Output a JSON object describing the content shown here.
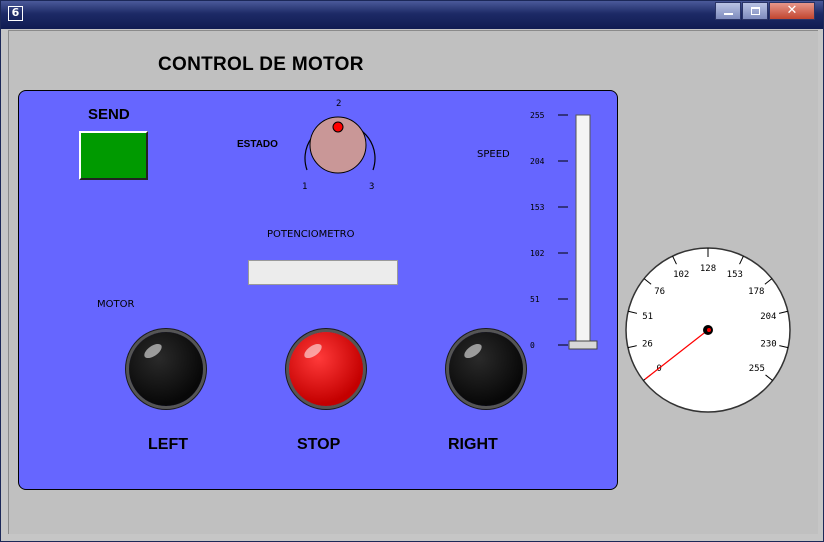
{
  "window": {
    "app_icon_glyph": "6",
    "minimize_icon": "minimize-icon",
    "maximize_icon": "maximize-icon",
    "close_glyph": "✕"
  },
  "heading": "CONTROL DE MOTOR",
  "panel_color": "#6666ff",
  "send": {
    "label": "SEND",
    "button_color": "#009a00"
  },
  "estado": {
    "label": "ESTADO",
    "ticks": [
      "1",
      "2",
      "3"
    ],
    "current": "2",
    "knob_color": "#c99797",
    "indicator_color": "#ff0000"
  },
  "speed_slider": {
    "label": "SPEED",
    "ticks": [
      "255",
      "204",
      "153",
      "102",
      "51",
      "0"
    ],
    "value": 0
  },
  "potenciometro": {
    "label": "POTENCIOMETRO",
    "value": ""
  },
  "motor": {
    "label": "MOTOR",
    "buttons": [
      {
        "label": "LEFT",
        "color": "#111111"
      },
      {
        "label": "STOP",
        "color": "#dd0000"
      },
      {
        "label": "RIGHT",
        "color": "#111111"
      }
    ]
  },
  "gauge": {
    "ticks": [
      "0",
      "26",
      "51",
      "76",
      "102",
      "128",
      "153",
      "178",
      "204",
      "230",
      "255"
    ],
    "value": 0,
    "needle_color": "#ff0000"
  }
}
